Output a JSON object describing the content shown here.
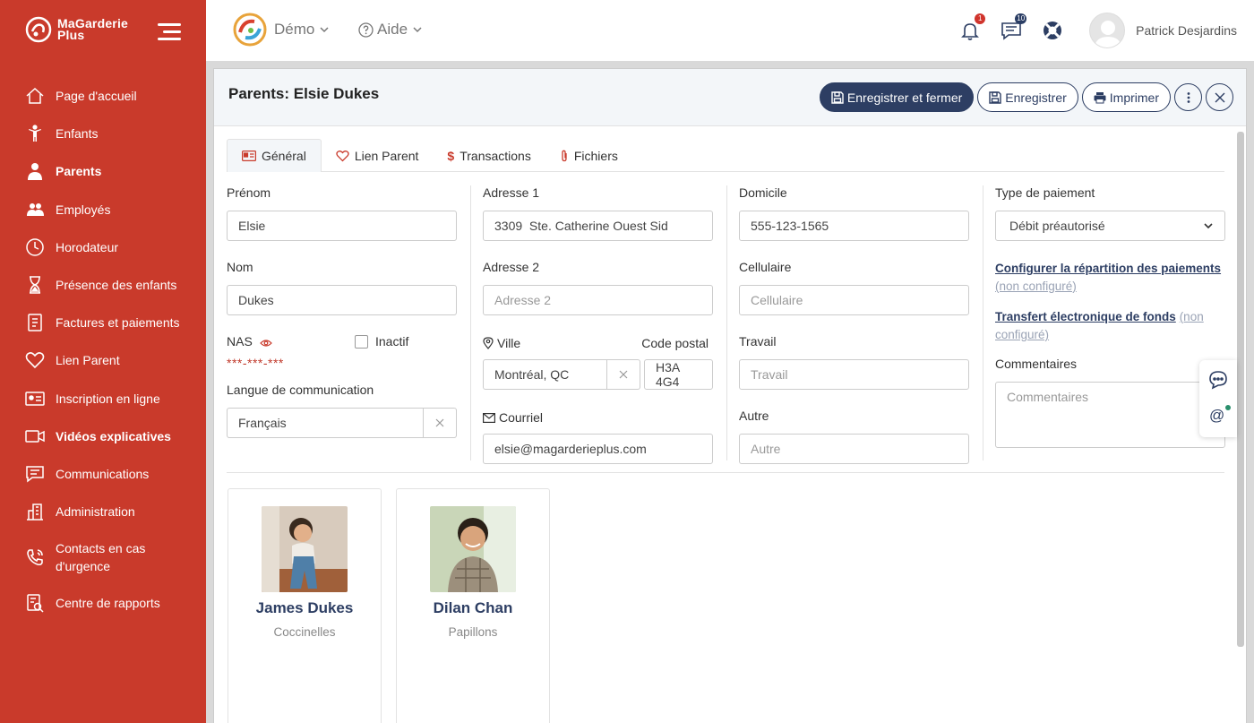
{
  "sidebar": {
    "brand_line1": "MaGarderie",
    "brand_line2": "Plus",
    "items": [
      {
        "label": "Page d'accueil",
        "icon": "home-icon"
      },
      {
        "label": "Enfants",
        "icon": "child-icon"
      },
      {
        "label": "Parents",
        "icon": "parent-icon",
        "active": true
      },
      {
        "label": "Employés",
        "icon": "employees-icon"
      },
      {
        "label": "Horodateur",
        "icon": "clock-icon"
      },
      {
        "label": "Présence des enfants",
        "icon": "hourglass-icon"
      },
      {
        "label": "Factures et paiements",
        "icon": "invoice-icon"
      },
      {
        "label": "Lien Parent",
        "icon": "heart-icon"
      },
      {
        "label": "Inscription en ligne",
        "icon": "id-card-icon"
      },
      {
        "label": "Vidéos explicatives",
        "icon": "video-icon"
      },
      {
        "label": "Communications",
        "icon": "chat-icon"
      },
      {
        "label": "Administration",
        "icon": "building-icon"
      },
      {
        "label": "Contacts en cas d'urgence",
        "icon": "phone-icon"
      },
      {
        "label": "Centre de rapports",
        "icon": "report-icon"
      }
    ]
  },
  "header": {
    "demo_label": "Démo",
    "help_label": "Aide",
    "notifications_count": "1",
    "messages_count": "10",
    "user_name": "Patrick Desjardins"
  },
  "panel": {
    "title": "Parents: Elsie Dukes",
    "buttons": {
      "save_close": "Enregistrer et fermer",
      "save": "Enregistrer",
      "print": "Imprimer"
    },
    "tabs": [
      "Général",
      "Lien Parent",
      "Transactions",
      "Fichiers"
    ]
  },
  "form": {
    "prenom_label": "Prénom",
    "prenom_value": "Elsie",
    "nom_label": "Nom",
    "nom_value": "Dukes",
    "nas_label": "NAS",
    "nas_value": "***-***-***",
    "inactif_label": "Inactif",
    "langue_label": "Langue de communication",
    "langue_value": "Français",
    "adresse1_label": "Adresse 1",
    "adresse1_value": "3309  Ste. Catherine Ouest Sid",
    "adresse2_label": "Adresse 2",
    "adresse2_placeholder": "Adresse 2",
    "ville_label": "Ville",
    "ville_value": "Montréal, QC",
    "code_postal_label": "Code postal",
    "code_postal_value": "H3A 4G4",
    "courriel_label": "Courriel",
    "courriel_value": "elsie@magarderieplus.com",
    "domicile_label": "Domicile",
    "domicile_value": "555-123-1565",
    "cellulaire_label": "Cellulaire",
    "cellulaire_placeholder": "Cellulaire",
    "travail_label": "Travail",
    "travail_placeholder": "Travail",
    "autre_label": "Autre",
    "autre_placeholder": "Autre",
    "type_paiement_label": "Type de paiement",
    "type_paiement_value": "Débit préautorisé",
    "config_link": "Configurer la répartition des paiements",
    "config_status": "(non configuré)",
    "transfert_link": "Transfert électronique de fonds",
    "transfert_status_1": "(non",
    "transfert_status_2": "configuré)",
    "commentaires_label": "Commentaires",
    "commentaires_placeholder": "Commentaires"
  },
  "children": [
    {
      "name": "James Dukes",
      "group": "Coccinelles"
    },
    {
      "name": "Dilan Chan",
      "group": "Papillons"
    }
  ],
  "colors": {
    "sidebar": "#c93a2b",
    "primary": "#2d3e63",
    "nas_red": "#c0392b"
  }
}
